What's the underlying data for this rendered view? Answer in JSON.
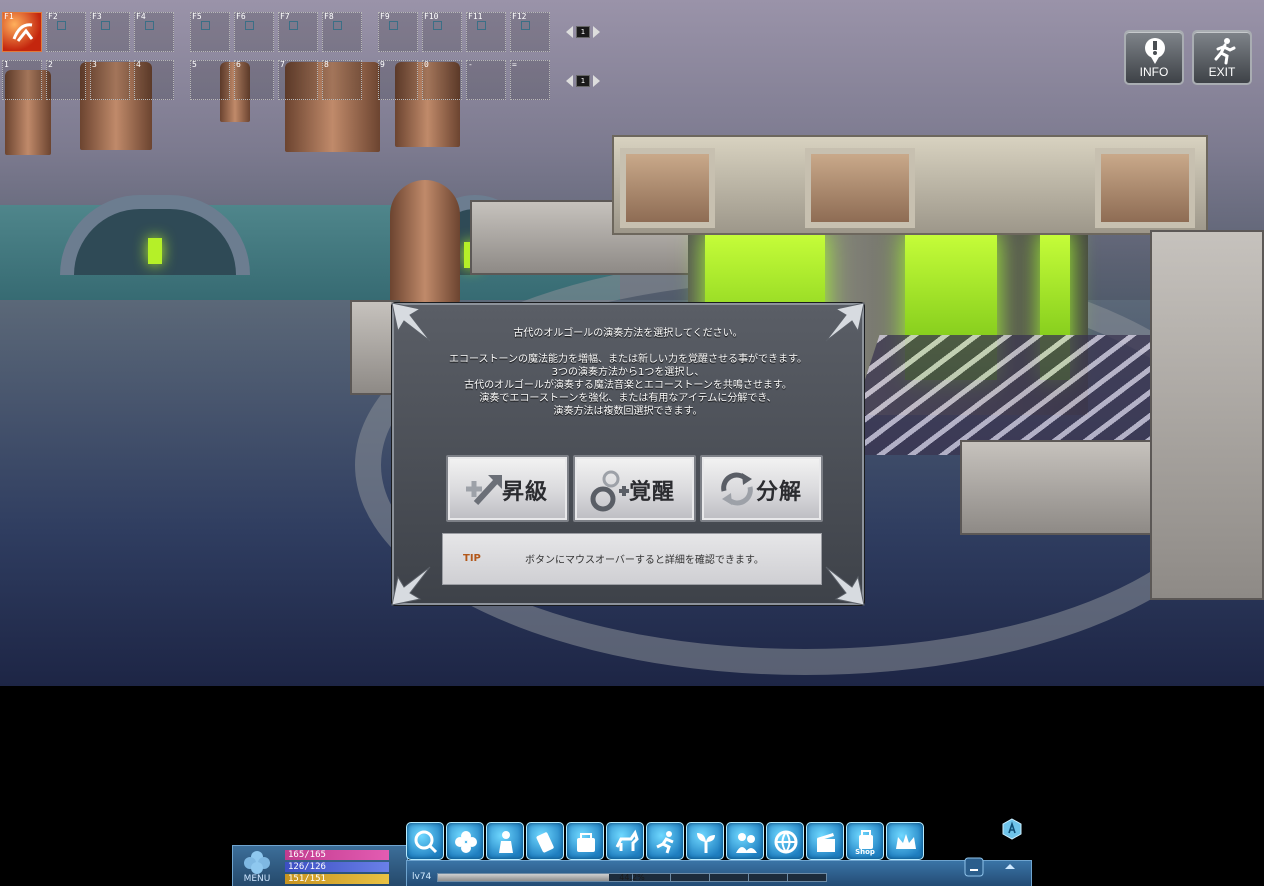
{
  "skillbar": {
    "row1_keys": [
      "F1",
      "F2",
      "F3",
      "F4",
      "F5",
      "F6",
      "F7",
      "F8",
      "F9",
      "F10",
      "F11",
      "F12"
    ],
    "row2_keys": [
      "1",
      "2",
      "3",
      "4",
      "5",
      "6",
      "7",
      "8",
      "9",
      "0",
      "-",
      "="
    ],
    "row1_page": "1",
    "row2_page": "1",
    "filled_slot_icon": "dash-skill-icon"
  },
  "system_buttons": {
    "info_label": "INFO",
    "info_icon": "exclamation-icon",
    "exit_label": "EXIT",
    "exit_icon": "running-man-icon"
  },
  "dialog": {
    "line1": "古代のオルゴールの演奏方法を選択してください。",
    "line2": "エコーストーンの魔法能力を増幅、または新しい力を覚醒させる事ができます。",
    "line3": "3つの演奏方法から1つを選択し、",
    "line4": "古代のオルゴールが演奏する魔法音楽とエコーストーンを共鳴させます。",
    "line5": "演奏でエコーストーンを強化、または有用なアイテムに分解でき、",
    "line6": "演奏方法は複数回選択できます。",
    "buttons": [
      {
        "label": "昇級",
        "icon": "upgrade-arrow-icon"
      },
      {
        "label": "覚醒",
        "icon": "awaken-circles-icon"
      },
      {
        "label": "分解",
        "icon": "recycle-arrows-icon"
      }
    ],
    "tip_label": "TIP",
    "tip_text": "ボタンにマウスオーバーすると詳細を確認できます。"
  },
  "hud": {
    "menu_label": "MENU",
    "hp": "165/165",
    "mp": "126/126",
    "sp": "151/151",
    "level": "lv74",
    "exp_text": "44.2%",
    "exp_fraction": 0.442,
    "shop_label": "Shop",
    "icons": [
      "search-icon",
      "clover-icon",
      "character-icon",
      "skill-icon",
      "inventory-icon",
      "pet-icon",
      "action-icon",
      "sprout-icon",
      "party-icon",
      "globe-icon",
      "clapperboard-icon",
      "shop-icon",
      "crown-icon"
    ]
  },
  "colors": {
    "hp": "#d84aa4",
    "mp": "#4f64d6",
    "sp": "#d9ae30",
    "tip": "#b3581a",
    "hud": "#2f6390"
  }
}
